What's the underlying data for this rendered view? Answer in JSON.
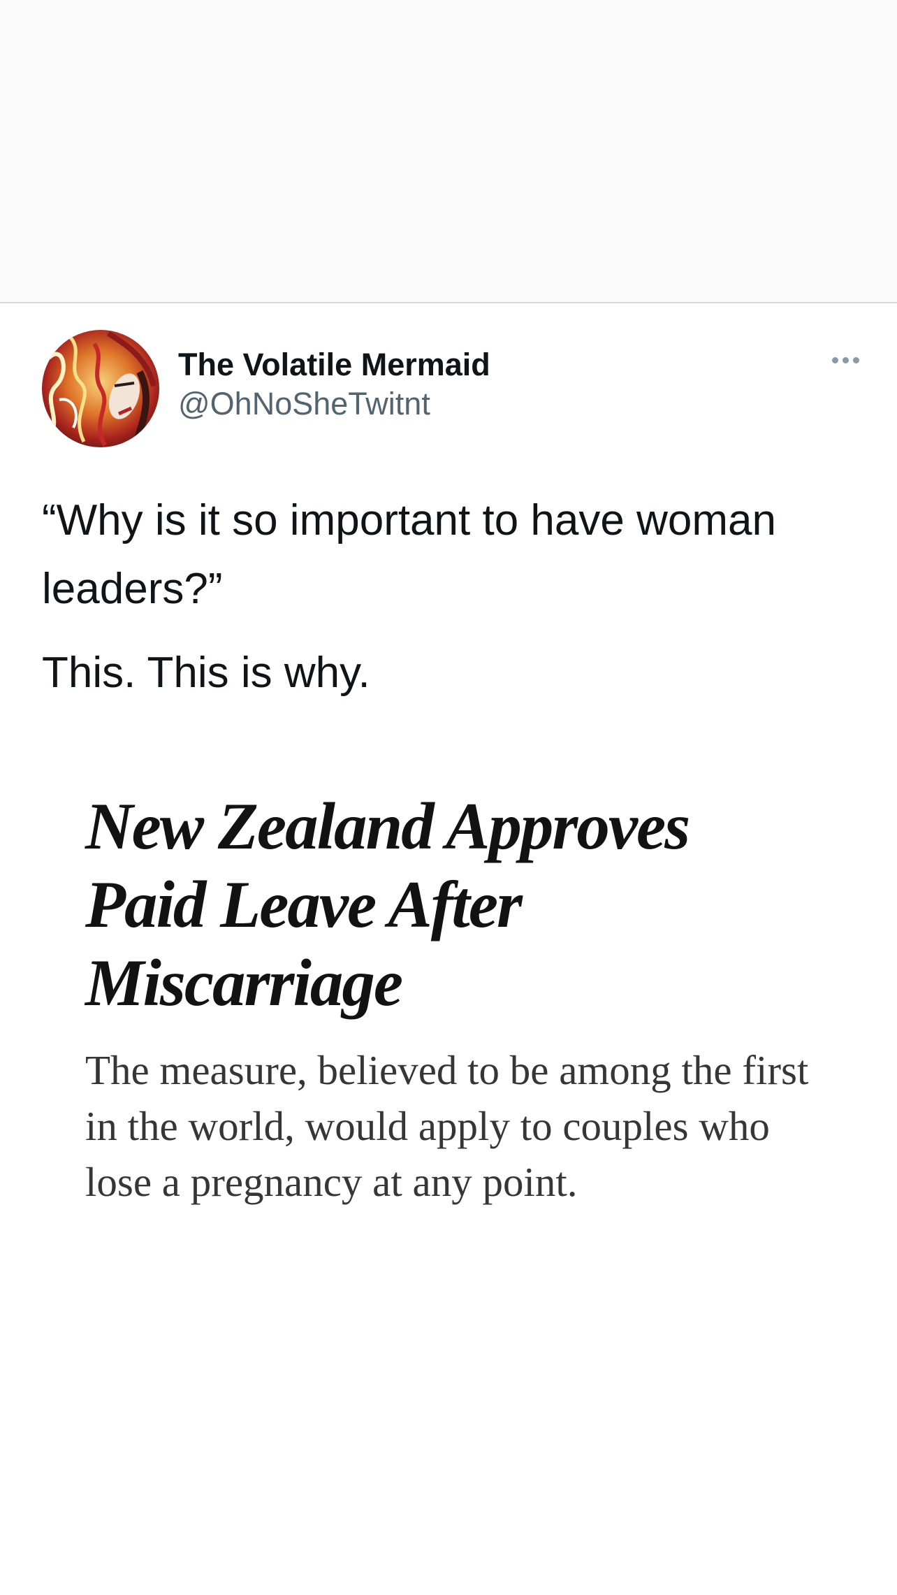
{
  "tweet": {
    "display_name": "The Volatile Mermaid",
    "handle": "@OhNoSheTwitnt",
    "text_line_1": "“Why is it so important to have woman leaders?”",
    "text_line_2": "This. This is why.",
    "more_icon": "more-horizontal-icon"
  },
  "article": {
    "headline": "New Zealand Approves Paid Leave After Miscarriage",
    "summary": "The measure, believed to be among the first in the world, would apply to couples who lose a pregnancy at any point."
  },
  "colors": {
    "name": "#0f1419",
    "handle": "#536471",
    "headline": "#121212",
    "summary": "#363636"
  }
}
